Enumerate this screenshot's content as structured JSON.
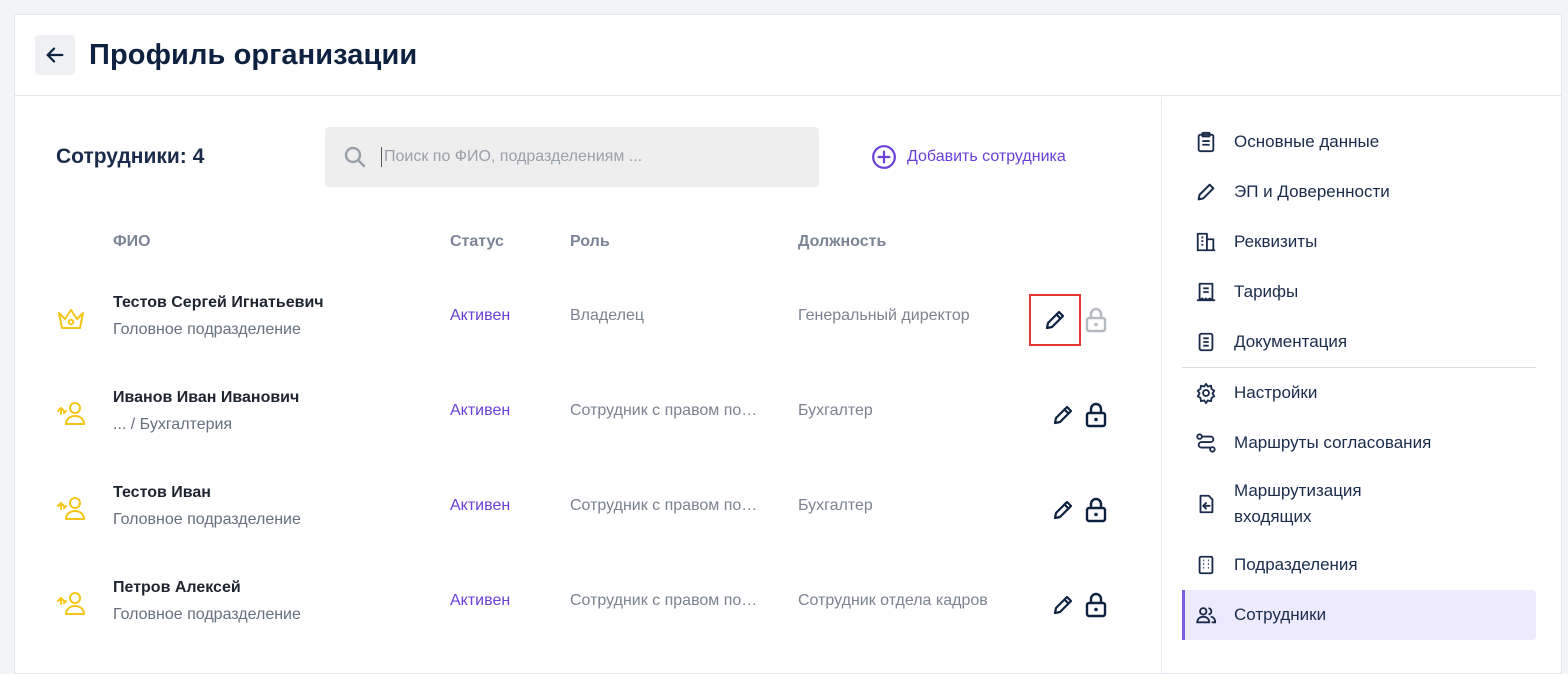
{
  "header": {
    "title": "Профиль организации"
  },
  "main": {
    "employees_label": "Сотрудники: 4",
    "search": {
      "placeholder": "Поиск по ФИО, подразделениям ...",
      "value": ""
    },
    "add_button": "Добавить сотрудника",
    "columns": {
      "name": "ФИО",
      "status": "Статус",
      "role": "Роль",
      "position": "Должность"
    },
    "rows": [
      {
        "icon": "crown-icon",
        "name": "Тестов Сергей Игнатьевич",
        "dept": "Головное подразделение",
        "status": "Активен",
        "role": "Владелец",
        "position": "Генеральный директор",
        "lock_disabled": true
      },
      {
        "icon": "user-transfer-icon",
        "name": "Иванов Иван Иванович",
        "dept": "... / Бухгалтерия",
        "status": "Активен",
        "role": "Сотрудник с правом по…",
        "position": "Бухгалтер",
        "lock_disabled": false
      },
      {
        "icon": "user-transfer-icon",
        "name": "Тестов Иван",
        "dept": "Головное подразделение",
        "status": "Активен",
        "role": "Сотрудник с правом по…",
        "position": "Бухгалтер",
        "lock_disabled": false
      },
      {
        "icon": "user-transfer-icon",
        "name": "Петров Алексей",
        "dept": "Головное подразделение",
        "status": "Активен",
        "role": "Сотрудник с правом по…",
        "position": "Сотрудник отдела кадров",
        "lock_disabled": false
      }
    ]
  },
  "sidebar": {
    "items": [
      {
        "icon": "clipboard-icon",
        "label": "Основные данные"
      },
      {
        "icon": "pen-icon",
        "label": "ЭП и Доверенности"
      },
      {
        "icon": "buildings-icon",
        "label": "Реквизиты"
      },
      {
        "icon": "receipt-icon",
        "label": "Тарифы"
      },
      {
        "icon": "document-icon",
        "label": "Документация"
      },
      {
        "icon": "gear-icon",
        "label": "Настройки"
      },
      {
        "icon": "route-icon",
        "label": "Маршруты согласования"
      },
      {
        "icon": "inbox-route-icon",
        "label": "Маршрутизация входящих"
      },
      {
        "icon": "building-icon",
        "label": "Подразделения"
      },
      {
        "icon": "users-icon",
        "label": "Сотрудники"
      }
    ]
  },
  "colors": {
    "accent": "#6a3fd9",
    "active_bg": "#eeeafd",
    "icon_yellow": "#f5c518",
    "highlight": "#e53935"
  }
}
